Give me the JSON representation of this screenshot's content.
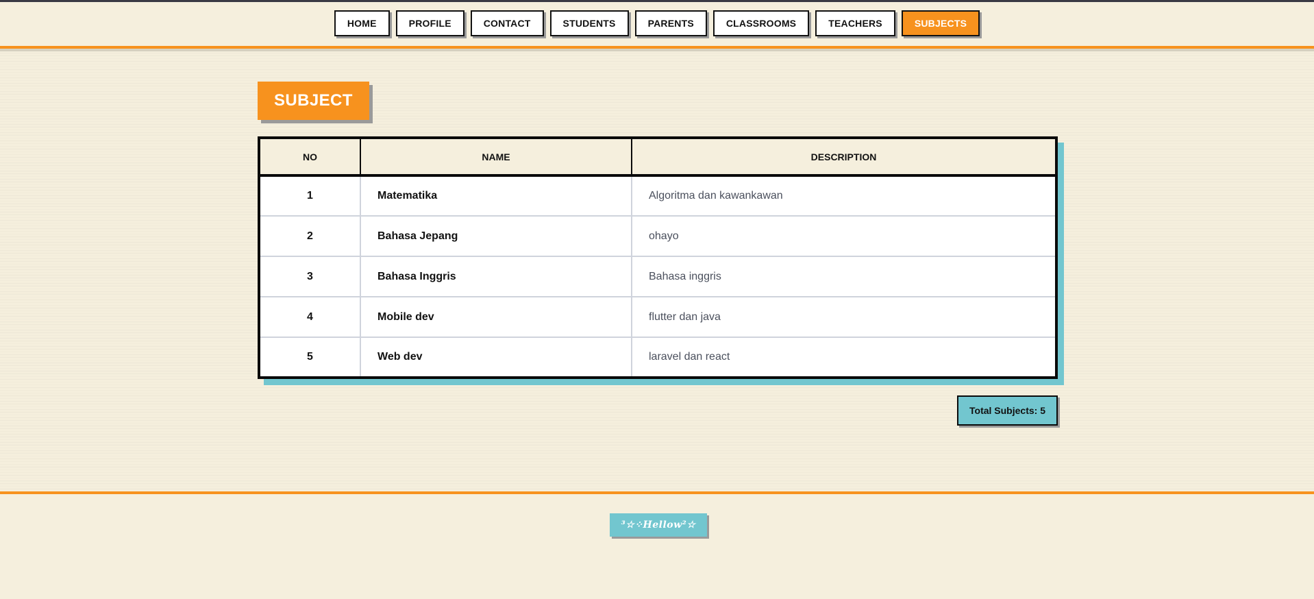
{
  "nav": {
    "items": [
      {
        "label": "HOME"
      },
      {
        "label": "PROFILE"
      },
      {
        "label": "CONTACT"
      },
      {
        "label": "STUDENTS"
      },
      {
        "label": "PARENTS"
      },
      {
        "label": "CLASSROOMS"
      },
      {
        "label": "TEACHERS"
      },
      {
        "label": "SUBJECTS"
      }
    ],
    "active": "SUBJECTS"
  },
  "page": {
    "title": "SUBJECT"
  },
  "table": {
    "headers": {
      "no": "NO",
      "name": "NAME",
      "description": "DESCRIPTION"
    },
    "rows": [
      {
        "no": "1",
        "name": "Matematika",
        "description": "Algoritma dan kawankawan"
      },
      {
        "no": "2",
        "name": "Bahasa Jepang",
        "description": "ohayo"
      },
      {
        "no": "3",
        "name": "Bahasa Inggris",
        "description": "Bahasa inggris"
      },
      {
        "no": "4",
        "name": "Mobile dev",
        "description": "flutter dan java"
      },
      {
        "no": "5",
        "name": "Web dev",
        "description": "laravel dan react"
      }
    ]
  },
  "summary": {
    "total_label": "Total Subjects: 5"
  },
  "footer": {
    "badge_text": "³☆⁘Hellow²☆"
  },
  "colors": {
    "accent": "#f7921e",
    "teal": "#72c6cf",
    "background": "#f5efdd",
    "border": "#0a0a0a"
  }
}
